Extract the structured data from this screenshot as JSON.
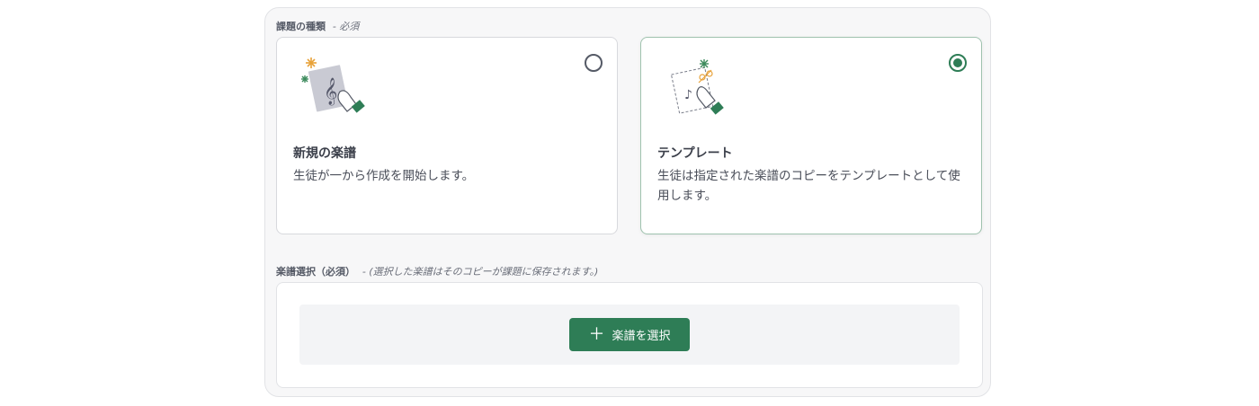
{
  "assignment_type": {
    "label": "課題の種類",
    "required_hint": "- 必須",
    "options": [
      {
        "title": "新規の楽譜",
        "description": "生徒が一から作成を開始します。",
        "selected": false
      },
      {
        "title": "テンプレート",
        "description": "生徒は指定された楽譜のコピーをテンプレートとして使用します。",
        "selected": true
      }
    ]
  },
  "score_selection": {
    "label": "楽譜選択（必須）",
    "hint": "- (選択した楽譜はそのコピーが課題に保存されます。)",
    "button_label": "楽譜を選択",
    "button_icon": "plus-icon"
  },
  "colors": {
    "accent": "#2e7d56",
    "panel_bg": "#f7f7f8",
    "selected_border": "#9fc2ae"
  }
}
